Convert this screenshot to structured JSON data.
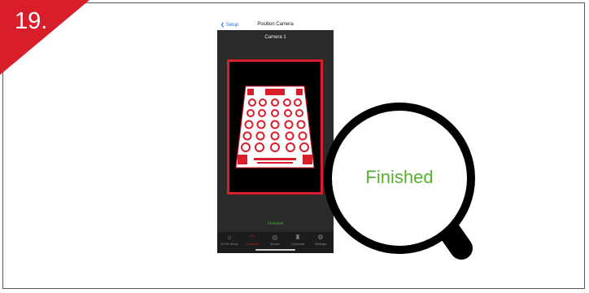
{
  "step": {
    "number": "19.",
    "color": "#d81e2a"
  },
  "phone": {
    "nav": {
      "back_label": "Setup",
      "title": "Position Camera"
    },
    "camera_title": "Camera 1",
    "status_text": "Finished",
    "tabs": [
      {
        "label": "XLR8 Setup",
        "icon": "home-icon",
        "active": false
      },
      {
        "label": "Connect",
        "icon": "wifi-icon",
        "active": true
      },
      {
        "label": "Boxes",
        "icon": "target-icon",
        "active": false
      },
      {
        "label": "Compete",
        "icon": "trophy-icon",
        "active": false
      },
      {
        "label": "Settings",
        "icon": "gear-icon",
        "active": false
      }
    ]
  },
  "magnifier": {
    "label": "Finished",
    "label_color": "#56b02f"
  }
}
